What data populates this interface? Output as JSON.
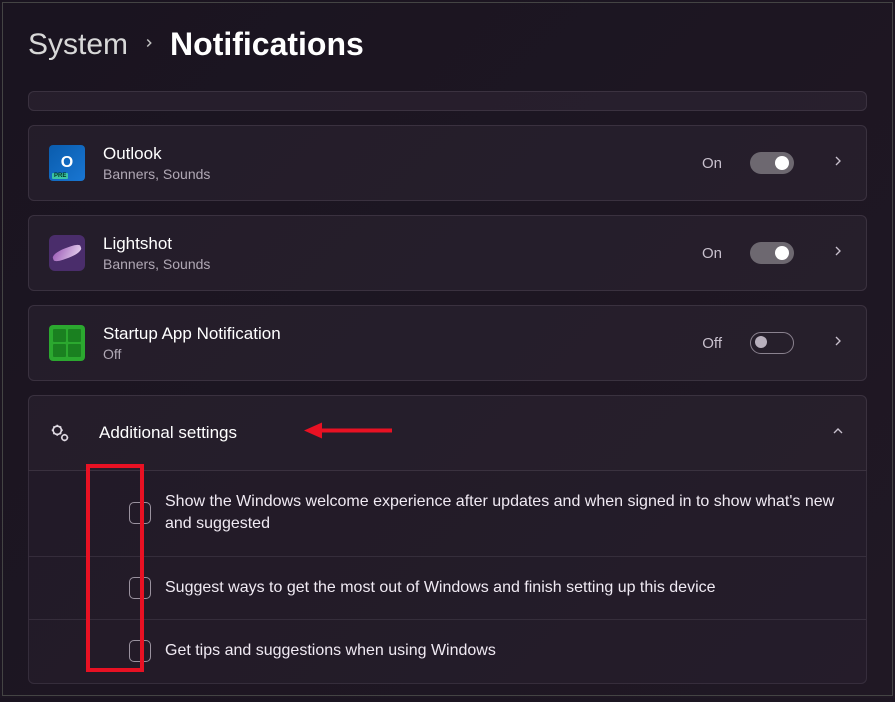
{
  "breadcrumb": {
    "parent": "System",
    "current": "Notifications"
  },
  "apps": [
    {
      "name": "Outlook",
      "subtitle": "Banners, Sounds",
      "state_label": "On",
      "state": true,
      "icon": "outlook"
    },
    {
      "name": "Lightshot",
      "subtitle": "Banners, Sounds",
      "state_label": "On",
      "state": true,
      "icon": "lightshot"
    },
    {
      "name": "Startup App Notification",
      "subtitle": "Off",
      "state_label": "Off",
      "state": false,
      "icon": "startup"
    }
  ],
  "section": {
    "title": "Additional settings",
    "expanded": true
  },
  "checkboxes": [
    {
      "label": "Show the Windows welcome experience after updates and when signed in to show what's new and suggested",
      "checked": false
    },
    {
      "label": "Suggest ways to get the most out of Windows and finish setting up this device",
      "checked": false
    },
    {
      "label": "Get tips and suggestions when using Windows",
      "checked": false
    }
  ]
}
